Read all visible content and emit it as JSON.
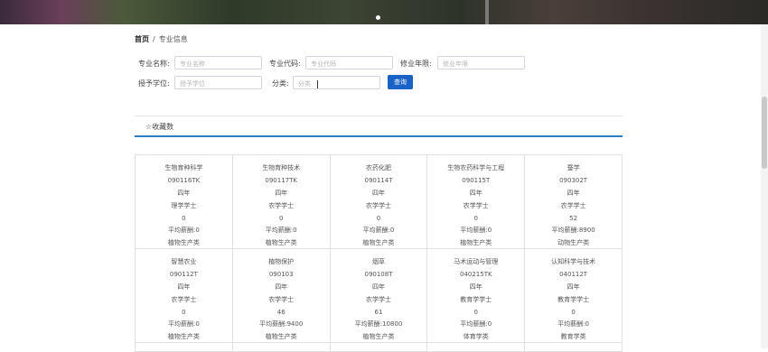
{
  "breadcrumb": {
    "home": "首页",
    "separator": "/",
    "current": "专业信息"
  },
  "search": {
    "name_label": "专业名称:",
    "name_placeholder": "专业名称",
    "code_label": "专业代码:",
    "code_placeholder": "专业代码",
    "years_label": "修业年限:",
    "years_placeholder": "修业年限",
    "degree_label": "授予学位:",
    "degree_placeholder": "授予学位",
    "category_label": "分类:",
    "category_placeholder": "分类",
    "query_button": "查询"
  },
  "favorites": {
    "label": "☆收藏数"
  },
  "majors": [
    [
      "生物育种科学",
      "090116TK",
      "四年",
      "理学学士",
      "0",
      "平均薪酬:0",
      "植物生产类"
    ],
    [
      "生物育种技术",
      "090117TK",
      "四年",
      "农学学士",
      "0",
      "平均薪酬:0",
      "植物生产类"
    ],
    [
      "农药化肥",
      "090114T",
      "四年",
      "农学学士",
      "0",
      "平均薪酬:0",
      "植物生产类"
    ],
    [
      "生物农药科学与工程",
      "090115T",
      "四年",
      "农学学士",
      "0",
      "平均薪酬:0",
      "植物生产类"
    ],
    [
      "蚕学",
      "090302T",
      "四年",
      "农学学士",
      "52",
      "平均薪酬:8900",
      "动物生产类"
    ],
    [
      "智慧农业",
      "090112T",
      "四年",
      "农学学士",
      "0",
      "平均薪酬:0",
      "植物生产类"
    ],
    [
      "植物保护",
      "090103",
      "四年",
      "农学学士",
      "46",
      "平均薪酬:9400",
      "植物生产类"
    ],
    [
      "烟草",
      "090108T",
      "四年",
      "农学学士",
      "61",
      "平均薪酬:10800",
      "植物生产类"
    ],
    [
      "马术运动与管理",
      "040215TK",
      "四年",
      "教育学学士",
      "0",
      "平均薪酬:0",
      "体育学类"
    ],
    [
      "认知科学与技术",
      "040112T",
      "四年",
      "教育学学士",
      "0",
      "平均薪酬:0",
      "教育学类"
    ]
  ]
}
